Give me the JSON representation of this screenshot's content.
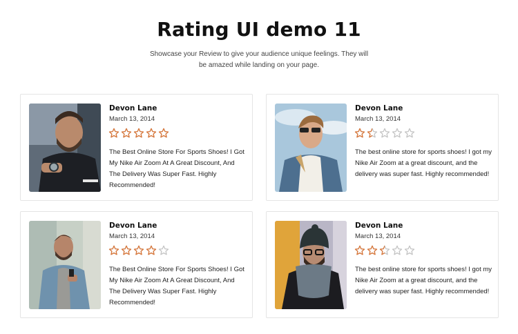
{
  "header": {
    "title": "Rating UI demo 11",
    "subtitle": "Showcase your Review to give your audience unique feelings. They will be amazed while landing on your page."
  },
  "colors": {
    "star_filled": "#d9773a",
    "star_empty": "#c4c4c4"
  },
  "reviews": [
    {
      "name": "Devon Lane",
      "date": "March 13, 2014",
      "rating": 5,
      "text": "The Best Online Store For Sports Shoes! I Got My Nike Air Zoom At A Great Discount, And The Delivery Was Super Fast. Highly Recommended!"
    },
    {
      "name": "Devon Lane",
      "date": "March 13, 2014",
      "rating": 1.5,
      "text": "The best online store for sports shoes! I got my Nike Air Zoom at a great discount, and the delivery was super fast. Highly recommended!"
    },
    {
      "name": "Devon Lane",
      "date": "March 13, 2014",
      "rating": 4,
      "text": "The Best Online Store For Sports Shoes! I Got My Nike Air Zoom At A Great Discount, And The Delivery Was Super Fast. Highly Recommended!"
    },
    {
      "name": "Devon Lane",
      "date": "March 13, 2014",
      "rating": 2.5,
      "text": "The best online store for sports shoes! I got my Nike Air Zoom at a great discount, and the delivery was super fast. Highly recommended!"
    }
  ]
}
